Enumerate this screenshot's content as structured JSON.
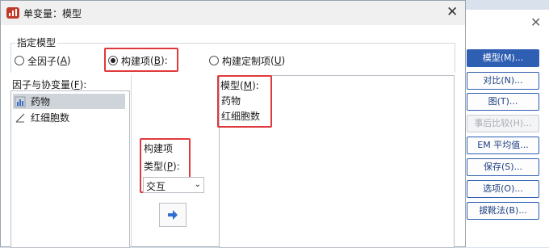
{
  "dialog": {
    "title": "单变量：模型"
  },
  "specify_model": {
    "legend": "指定模型",
    "options": [
      {
        "label": "全因子",
        "hotkey": "A",
        "checked": false
      },
      {
        "label": "构建项",
        "hotkey": "B",
        "suffix": ":",
        "checked": true
      },
      {
        "label": "构建定制项",
        "hotkey": "U",
        "checked": false
      }
    ]
  },
  "factors": {
    "label": "因子与协变量",
    "hotkey": "F",
    "items": [
      {
        "name": "药物",
        "icon": "nominal-bar-chart-icon",
        "selected": true
      },
      {
        "name": "红细胞数",
        "icon": "scale-ruler-icon",
        "selected": false
      }
    ]
  },
  "build_terms": {
    "heading": "构建项",
    "type_label": "类型",
    "type_hotkey": "P",
    "type_value": "交互",
    "move_icon": "right-arrow-icon"
  },
  "model": {
    "label": "模型",
    "hotkey": "M",
    "items": [
      "药物",
      "红细胞数"
    ]
  },
  "side_buttons": [
    {
      "label": "模型(M)...",
      "state": "active"
    },
    {
      "label": "对比(N)...",
      "state": "normal"
    },
    {
      "label": "图(T)...",
      "state": "normal"
    },
    {
      "label": "事后比较(H)...",
      "state": "disabled"
    },
    {
      "label": "EM 平均值...",
      "state": "normal"
    },
    {
      "label": "保存(S)...",
      "state": "normal"
    },
    {
      "label": "选项(O)...",
      "state": "normal"
    },
    {
      "label": "拔靴法(B)...",
      "state": "normal"
    }
  ],
  "colors": {
    "accent": "#2f5fb3",
    "highlight_box": "#e0393b",
    "selection": "#cfd4db"
  }
}
